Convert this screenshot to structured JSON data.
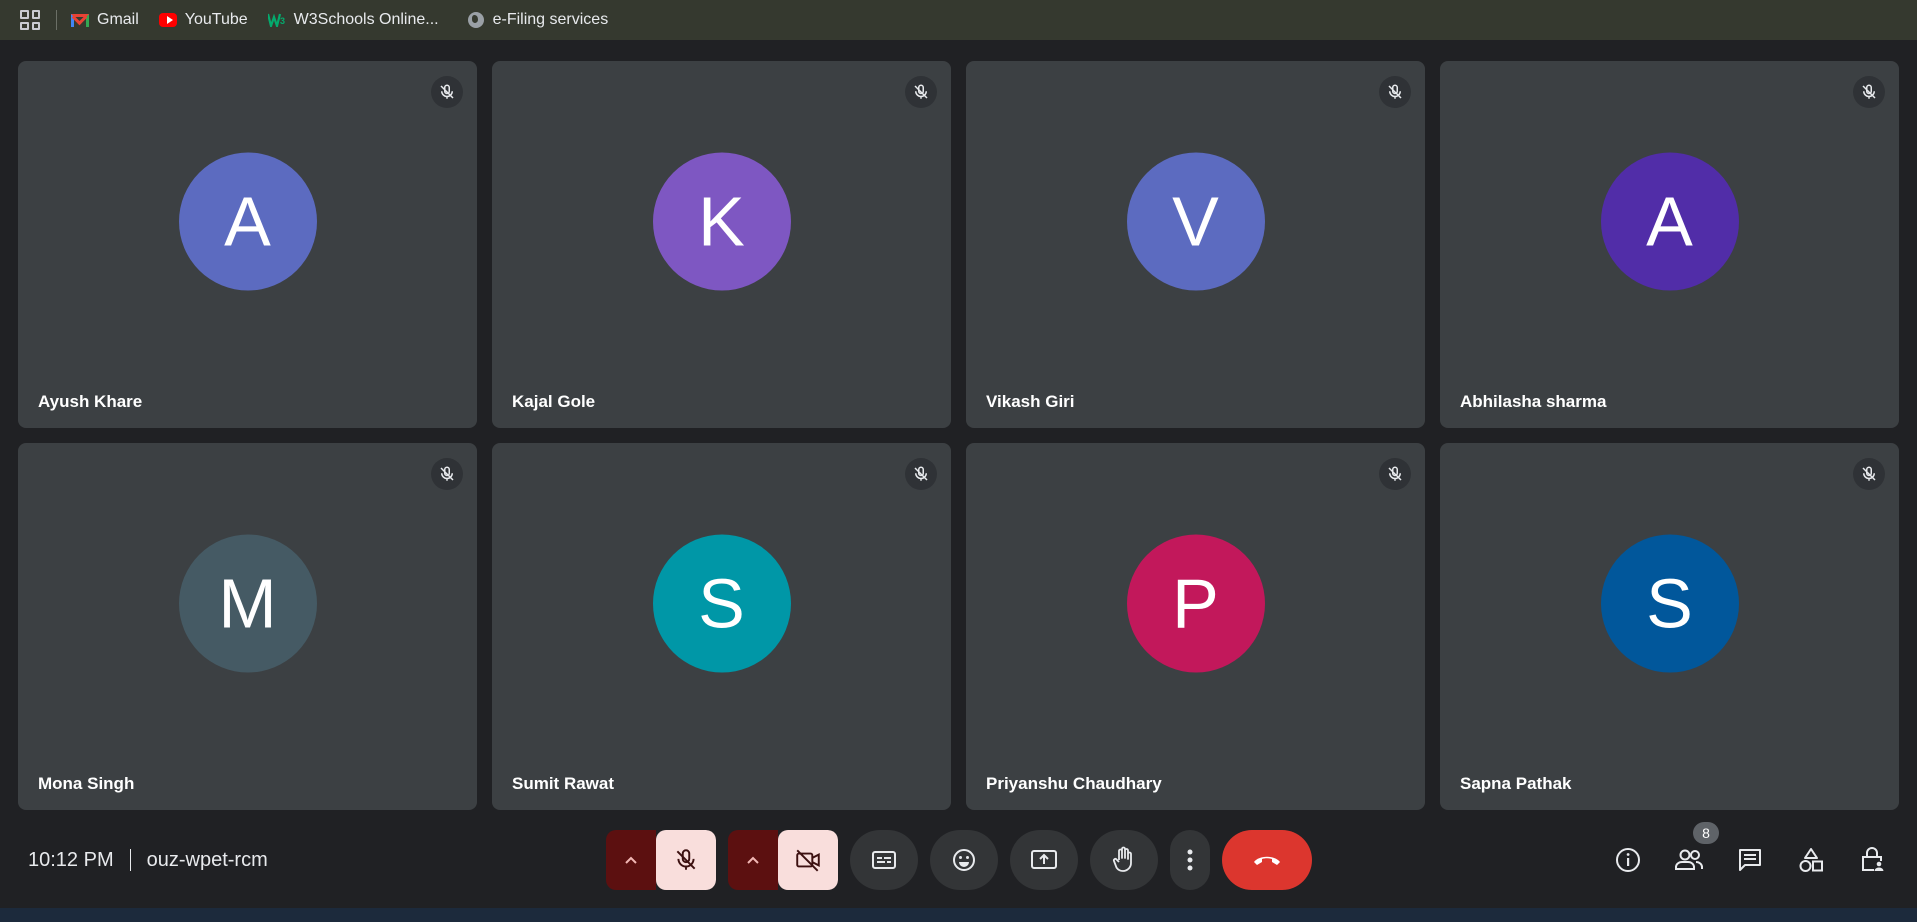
{
  "bookmarks": [
    {
      "label": "Gmail",
      "icon": "gmail-icon"
    },
    {
      "label": "YouTube",
      "icon": "youtube-icon"
    },
    {
      "label": "W3Schools Online...",
      "icon": "w3schools-icon"
    },
    {
      "label": "e-Filing services",
      "icon": "globe-icon"
    }
  ],
  "participants": [
    {
      "name": "Ayush Khare",
      "initial": "A",
      "color": "#5c6bc0"
    },
    {
      "name": "Kajal Gole",
      "initial": "K",
      "color": "#7e57c2"
    },
    {
      "name": "Vikash Giri",
      "initial": "V",
      "color": "#5c6bc0"
    },
    {
      "name": "Abhilasha sharma",
      "initial": "A",
      "color": "#512da8"
    },
    {
      "name": "Mona Singh",
      "initial": "M",
      "color": "#455a64"
    },
    {
      "name": "Sumit Rawat",
      "initial": "S",
      "color": "#0097a7"
    },
    {
      "name": "Priyanshu Chaudhary",
      "initial": "P",
      "color": "#c2185b"
    },
    {
      "name": "Sapna Pathak",
      "initial": "S",
      "color": "#01579b"
    }
  ],
  "footer": {
    "time": "10:12 PM",
    "meeting_code": "ouz-wpet-rcm",
    "people_count": "8"
  },
  "colors": {
    "hangup": "#dc362e",
    "muted_bg": "#f9dedc",
    "muted_icon": "#b3261e"
  }
}
